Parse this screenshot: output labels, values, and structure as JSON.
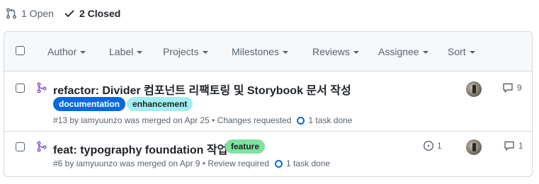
{
  "states": {
    "open_label": "1 Open",
    "closed_label": "2 Closed"
  },
  "filters": [
    {
      "label": "Author"
    },
    {
      "label": "Label"
    },
    {
      "label": "Projects"
    },
    {
      "label": "Milestones"
    },
    {
      "label": "Reviews"
    },
    {
      "label": "Assignee"
    },
    {
      "label": "Sort"
    }
  ],
  "pull_requests": [
    {
      "title": "refactor: Divider 컴포넌트 리팩토링 및 Storybook 문서 작성",
      "labels": [
        {
          "name": "documentation",
          "color": "#0969da"
        },
        {
          "name": "enhancement",
          "color": "#a2eeef"
        }
      ],
      "meta": "#13 by iamyuunzo was merged on Apr 25 • Changes requested",
      "tasks": "1 task done",
      "comments": "9",
      "status_icon": "git-merge-icon"
    },
    {
      "title": "feat: typography foundation 작업",
      "labels": [
        {
          "name": "feature",
          "color": "#7ee2a1"
        }
      ],
      "meta": "#6 by iamyuunzo was merged on Apr 9 • Review required",
      "tasks": "1 task done",
      "linked_issues": "1",
      "comments": "1",
      "status_icon": "git-merge-icon"
    }
  ],
  "colors": {
    "merged": "#8250df",
    "border": "#d1d9e0",
    "header_bg": "#f6f8fa",
    "muted": "#59636e"
  }
}
